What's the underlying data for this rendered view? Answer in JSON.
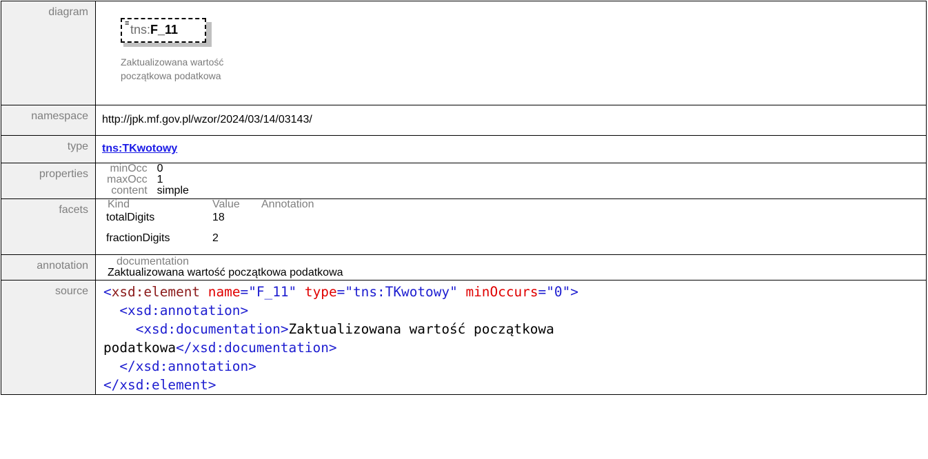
{
  "labels": {
    "diagram": "diagram",
    "namespace": "namespace",
    "type": "type",
    "properties": "properties",
    "facets": "facets",
    "annotation": "annotation",
    "source": "source"
  },
  "diagram": {
    "element_prefix": "tns:",
    "element_name": "F_11",
    "description_line1": "Zaktualizowana wartość",
    "description_line2": "początkowa podatkowa"
  },
  "namespace": "http://jpk.mf.gov.pl/wzor/2024/03/14/03143/",
  "type": "tns:TKwotowy",
  "properties": [
    {
      "key": "minOcc",
      "value": "0"
    },
    {
      "key": "maxOcc",
      "value": "1"
    },
    {
      "key": "content",
      "value": "simple"
    }
  ],
  "facets": {
    "headers": [
      "Kind",
      "Value",
      "Annotation"
    ],
    "rows": [
      {
        "kind": "totalDigits",
        "value": "18",
        "annotation": ""
      },
      {
        "kind": "fractionDigits",
        "value": "2",
        "annotation": ""
      }
    ]
  },
  "annotation": {
    "label": "documentation",
    "text": "Zaktualizowana wartość początkowa podatkowa"
  },
  "source": {
    "l1_open": "<",
    "l1_tag": "xsd:element",
    "l1_attr1": "name",
    "l1_val1": "\"F_11\"",
    "l1_attr2": "type",
    "l1_val2": "\"tns:TKwotowy\"",
    "l1_attr3": "minOccurs",
    "l1_val3": "\"0\"",
    "l1_close": ">",
    "l2": "<xsd:annotation>",
    "l3_open": "<xsd:documentation>",
    "l3_text": "Zaktualizowana wartość początkowa",
    "l4_text": "podatkowa",
    "l4_close": "</xsd:documentation>",
    "l5": "</xsd:annotation>",
    "l6": "</xsd:element>"
  }
}
